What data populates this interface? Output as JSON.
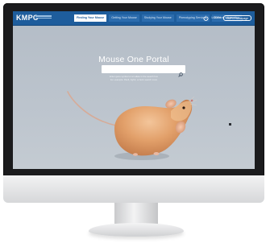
{
  "brand": {
    "logo_text": "KMPC",
    "accent_color": "#1e5d9c"
  },
  "nav": {
    "tabs": [
      {
        "label": "Finding Your Mouse"
      },
      {
        "label": "Getting Your Mouse"
      },
      {
        "label": "Studying Your Mouse"
      },
      {
        "label": "Phenotyping Services"
      },
      {
        "label": "General Information"
      }
    ],
    "active_tab": 0,
    "login_label": "LOGIN",
    "register_label": "KMPC Homepage",
    "login_icon": "power-icon"
  },
  "hero": {
    "title": "Mouse One Portal",
    "search_placeholder": "",
    "search_icon": "search-icon",
    "hint_line_1": "Enter gene symbol or an allele in the search box",
    "hint_line_2": "For example: Pax6, Fgfr2, or Ext1 search more"
  }
}
